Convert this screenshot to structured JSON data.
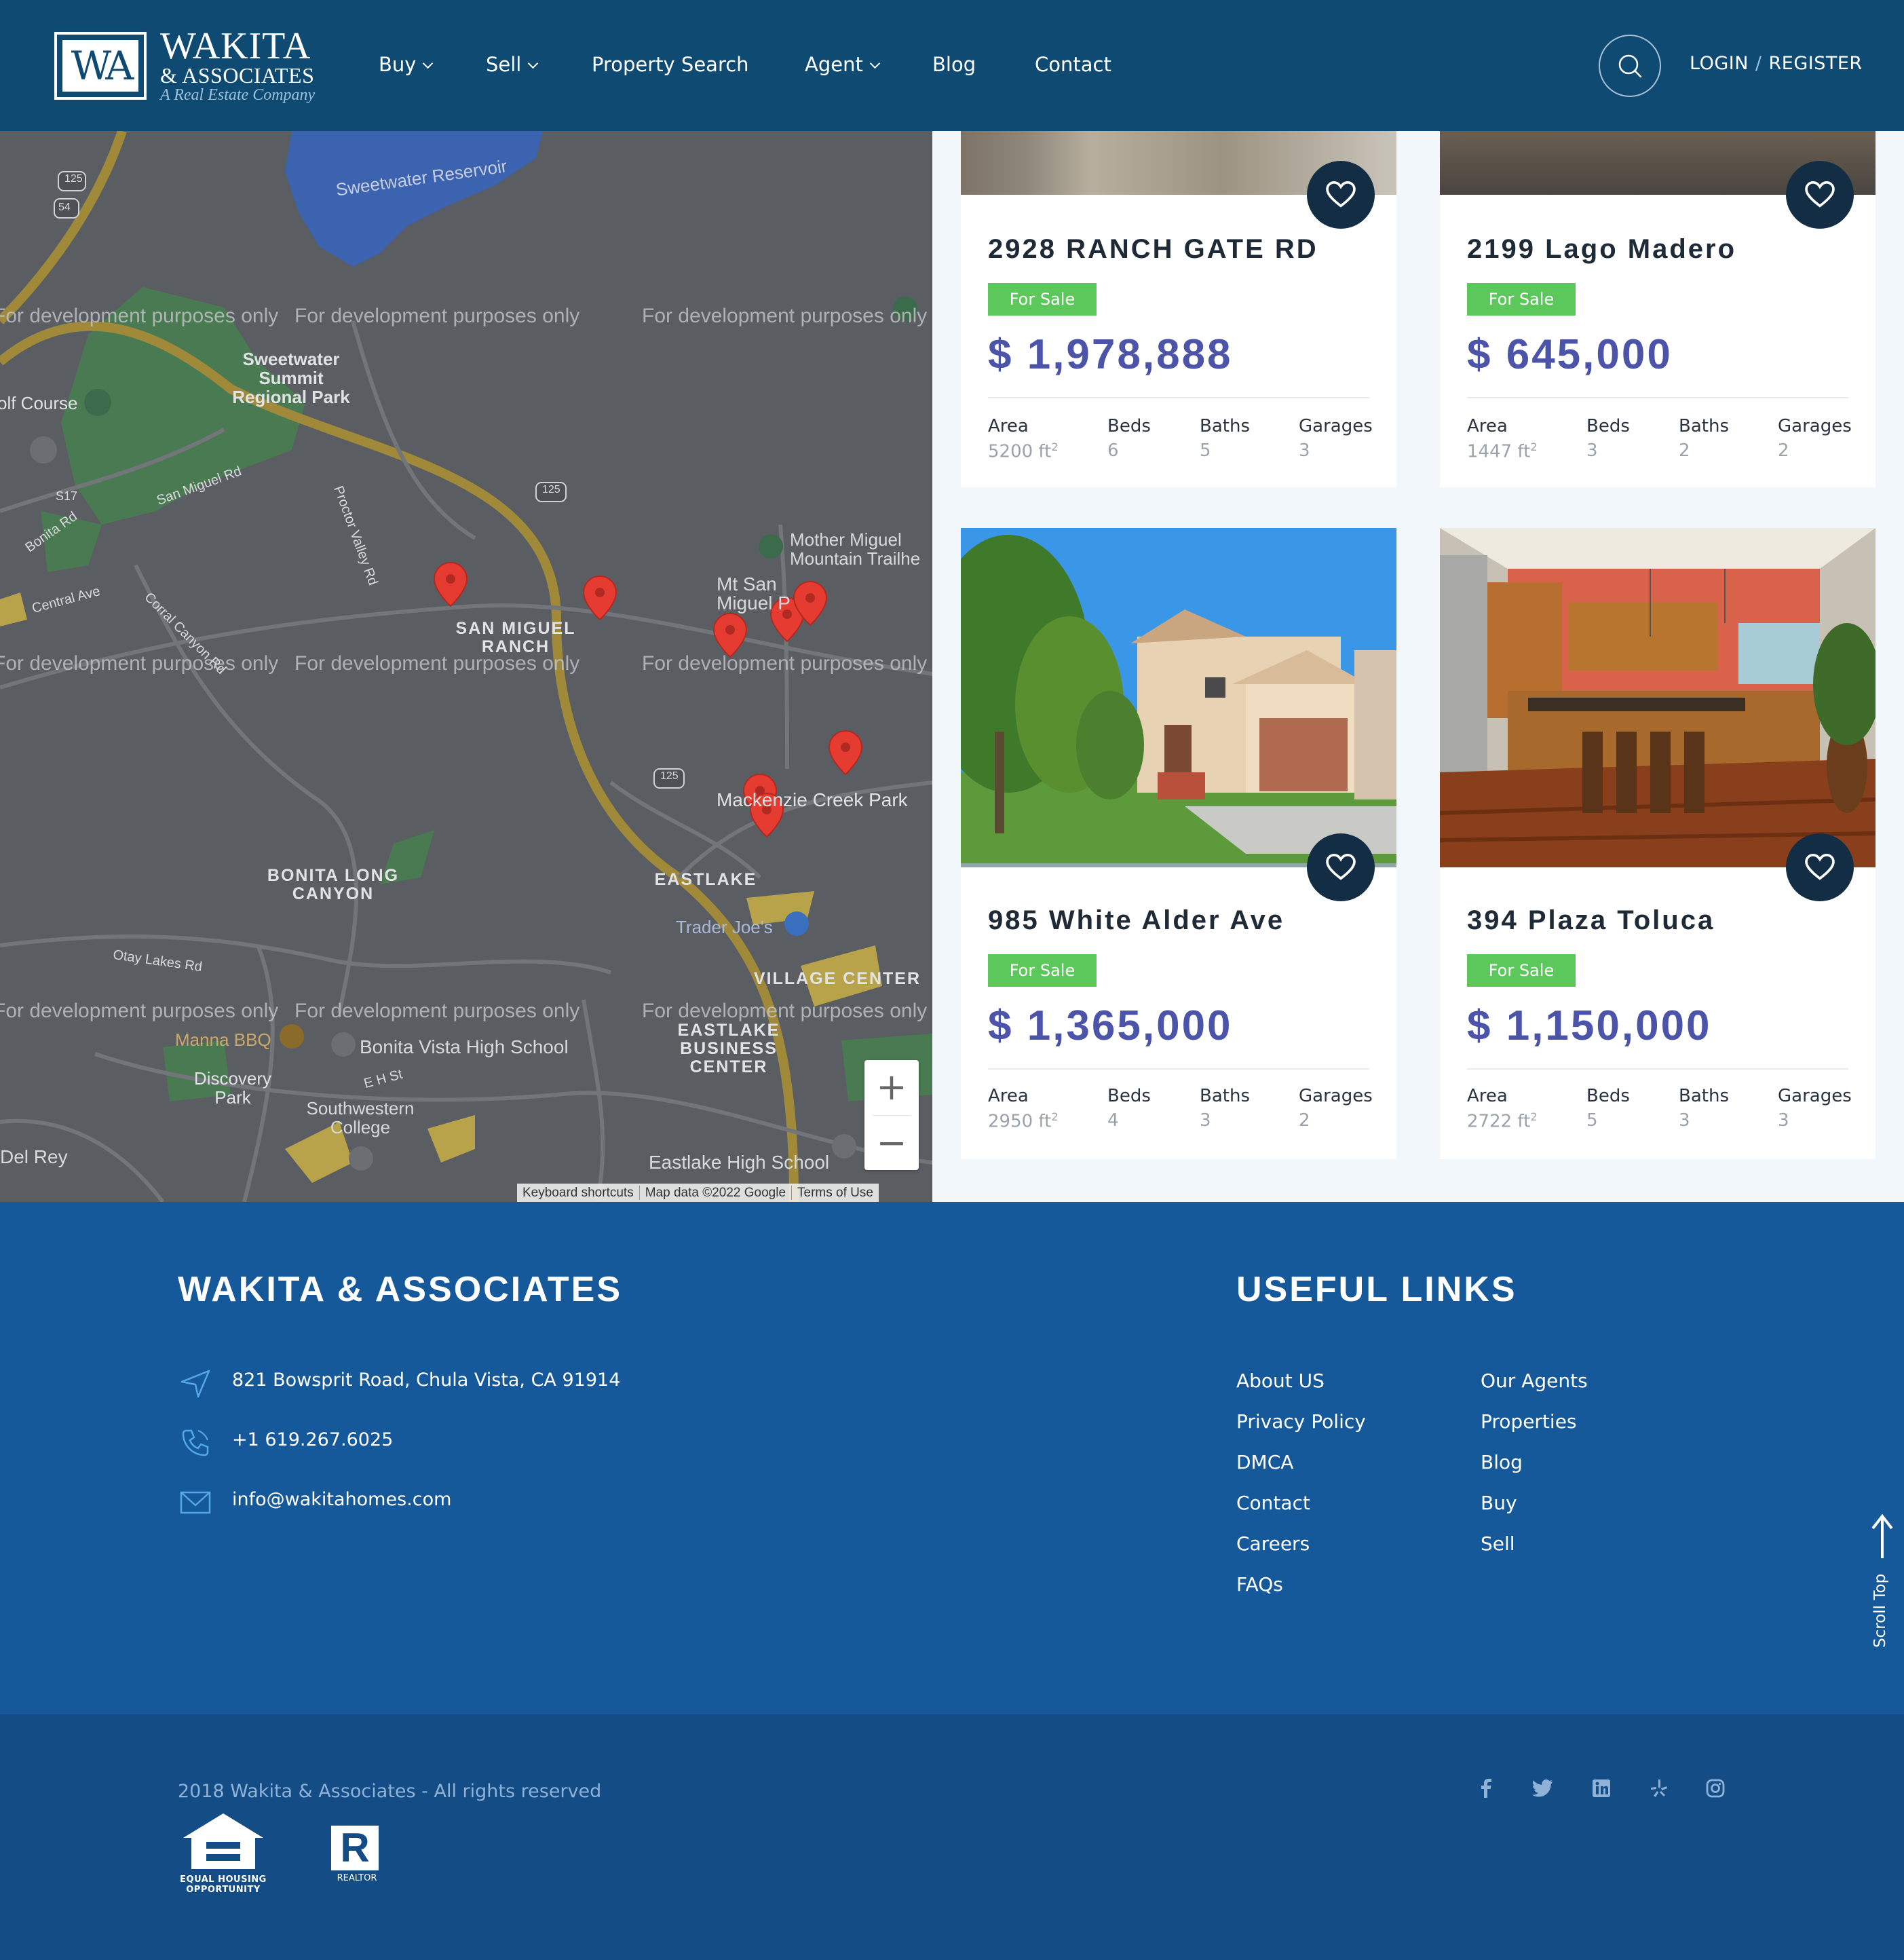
{
  "header": {
    "logo_mark": "WA",
    "logo_name": "WAKITA",
    "logo_sub": "& ASSOCIATES",
    "logo_tagline": "A Real Estate Company",
    "nav": [
      {
        "label": "Buy",
        "dropdown": true
      },
      {
        "label": "Sell",
        "dropdown": true
      },
      {
        "label": "Property Search",
        "dropdown": false
      },
      {
        "label": "Agent",
        "dropdown": true
      },
      {
        "label": "Blog",
        "dropdown": false
      },
      {
        "label": "Contact",
        "dropdown": false
      }
    ],
    "login": "LOGIN",
    "separator": "/",
    "register": "REGISTER",
    "search_icon": "search-icon"
  },
  "map": {
    "watermark": "For development purposes only",
    "labels": {
      "reservoir": "Sweetwater Reservoir",
      "park1": "Sweetwater Summit Regional Park",
      "golf": "olf Course",
      "san_miguel_rd": "San Miguel Rd",
      "proctor": "Proctor Valley Rd",
      "mother_miguel": "Mother Miguel Mountain Trailhe",
      "mt_san_miguel": "Mt San Miguel P",
      "central": "Central Ave",
      "corral": "Corral Canyon Rd",
      "san_miguel_ranch": "SAN MIGUEL RANCH",
      "bonita_long": "BONITA LONG CANYON",
      "eastlake": "EASTLAKE",
      "mackenzie": "Mackenzie Creek Park",
      "trader": "Trader Joe's",
      "village": "VILLAGE CENTER",
      "eastlake_bc": "EASTLAKE BUSINESS CENTER",
      "otay": "Otay Lakes Rd",
      "manna": "Manna BBQ",
      "bonita_vista": "Bonita Vista High School",
      "discovery": "Discovery Park",
      "southwestern": "Southwestern College",
      "eastlake_hs": "Eastlake High School",
      "del_rey": "Del Rey",
      "ehst": "E H St",
      "bonita_rd": "Bonita Rd",
      "s17": "S17",
      "r125": "125",
      "r54": "54"
    },
    "zoom_in": "+",
    "zoom_out": "−",
    "attribution": [
      "Keyboard shortcuts",
      "Map data ©2022 Google",
      "Terms of Use"
    ],
    "google": "Google"
  },
  "listings": [
    {
      "title": "2928 RANCH GATE RD",
      "status": "For Sale",
      "price": "$ 1,978,888",
      "area": "5200 ft",
      "beds": "6",
      "baths": "5",
      "garages": "3"
    },
    {
      "title": "2199 Lago Madero",
      "status": "For Sale",
      "price": "$ 645,000",
      "area": "1447 ft",
      "beds": "3",
      "baths": "2",
      "garages": "2"
    },
    {
      "title": "985 White Alder Ave",
      "status": "For Sale",
      "price": "$ 1,365,000",
      "area": "2950 ft",
      "beds": "4",
      "baths": "3",
      "garages": "2"
    },
    {
      "title": "394 Plaza Toluca",
      "status": "For Sale",
      "price": "$ 1,150,000",
      "area": "2722 ft",
      "beds": "5",
      "baths": "3",
      "garages": "3"
    }
  ],
  "spec_labels": {
    "area": "Area",
    "beds": "Beds",
    "baths": "Baths",
    "garages": "Garages",
    "area_sup": "2"
  },
  "footer": {
    "company_title": "WAKITA & ASSOCIATES",
    "address": "821 Bowsprit Road, Chula Vista, CA 91914",
    "phone": "+1 619.267.6025",
    "email": "info@wakitahomes.com",
    "links_title": "USEFUL LINKS",
    "links_col1": [
      "About US",
      "Privacy Policy",
      "DMCA",
      "Contact",
      "Careers",
      "FAQs"
    ],
    "links_col2": [
      "Our Agents",
      "Properties",
      "Blog",
      "Buy",
      "Sell"
    ],
    "scroll_top": "Scroll Top",
    "copyright": "2018 Wakita & Associates - All rights reserved",
    "eho_line1": "EQUAL HOUSING",
    "eho_line2": "OPPORTUNITY",
    "realtor": "REALTOR",
    "realtor_mark": "R",
    "social": [
      "facebook-icon",
      "twitter-icon",
      "linkedin-icon",
      "yelp-icon",
      "instagram-icon"
    ],
    "social_glyphs": [
      "f",
      "t",
      "in",
      "y",
      "ig"
    ]
  },
  "colors": {
    "header_bg": "#0e4a72",
    "footer_bg": "#15599b",
    "bottom_bg": "#144c86",
    "price": "#4b54a8",
    "badge": "#5cc85b",
    "heart_bg": "#132e44",
    "pin": "#e53b30"
  }
}
